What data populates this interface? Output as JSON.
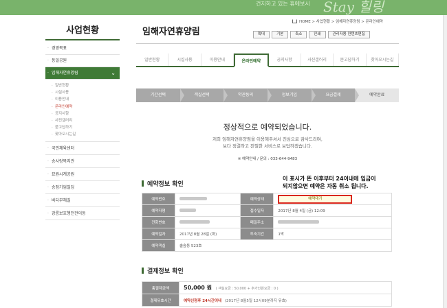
{
  "header": {
    "slogan": "건지하고 있는 휴에보시",
    "stay_logo": "Stay 힐링"
  },
  "sidebar": {
    "title": "사업현황",
    "items": [
      {
        "label": "경영목표"
      },
      {
        "label": "동일공원"
      },
      {
        "label": "임해자연휴양림",
        "active": true,
        "chevron": "⌄"
      },
      {
        "label": "국민체육센터"
      },
      {
        "label": "송사랑복지관"
      },
      {
        "label": "묘원시계공원"
      },
      {
        "label": "송정기업빌딩"
      },
      {
        "label": "바다부채길"
      },
      {
        "label": "강릉보호행전전이동"
      }
    ],
    "subitems": [
      {
        "label": "일반현황"
      },
      {
        "label": "시설사용"
      },
      {
        "label": "이용안내"
      },
      {
        "label": "온라인예약",
        "current": true
      },
      {
        "label": "공지사항"
      },
      {
        "label": "사진갤러리"
      },
      {
        "label": "묻고답하기"
      },
      {
        "label": "찾아오시는길"
      }
    ]
  },
  "main": {
    "title": "임해자연휴양림",
    "breadcrumb": "HOME  >  사업현황  >  임해자연휴양림  >  온라인예약",
    "util_buttons": [
      "확대",
      "기본",
      "축소",
      "인쇄",
      "관리자용 컨텐츠편집"
    ],
    "tabs": [
      {
        "label": "일반현황"
      },
      {
        "label": "시설사용"
      },
      {
        "label": "이용안내"
      },
      {
        "label": "온라인예약",
        "active": true
      },
      {
        "label": "공지사항"
      },
      {
        "label": "사진갤러리"
      },
      {
        "label": "묻고답하기"
      },
      {
        "label": "찾아오시는길"
      }
    ],
    "steps": [
      {
        "label": "기간선택"
      },
      {
        "label": "객실선택"
      },
      {
        "label": "약관동의"
      },
      {
        "label": "정보기입"
      },
      {
        "label": "요금결제"
      },
      {
        "label": "예약완료",
        "current": true
      }
    ],
    "complete": {
      "headline": "정상적으로 예약되었습니다.",
      "thanks_line1": "저희 임해자연휴양림을 이용해주셔서 진심으로 감사드리며,",
      "thanks_line2": "보다 정결하고 친절한 서비스로 보답하겠습니다.",
      "contact": "※ 예약안내 / 문의 : 033-644-9483"
    },
    "reservation_section_title": "예약정보 확인",
    "notice_line1": "이 표시가 뜬 이후부터 24이내에 입금이",
    "notice_line2": "되지않으면 예약은 자동 취소 됩니다.",
    "reservation": {
      "rows": [
        {
          "l1": "예약번호",
          "v1": "",
          "l2": "예약상태",
          "v2": "예약대기"
        },
        {
          "l1": "예약자명",
          "v1": "",
          "l2": "접수일자",
          "v2": "2017년 8월 4일 (금) 12:09"
        },
        {
          "l1": "전화번호",
          "v1": "",
          "l2": "메일주소",
          "v2": ""
        },
        {
          "l1": "예약일자",
          "v1": "2017년 8월 28일 (화)",
          "l2": "투숙기간",
          "v2": "1박"
        },
        {
          "l1": "예약객실",
          "v1": "솔숲동 523호"
        }
      ]
    },
    "payment_section_title": "결제정보 확인",
    "payment": {
      "total_label": "총결제금액",
      "total_value": "50,000 원",
      "total_note": "( 객실요금 : 50,000 + 추가인원요금 : 0 )",
      "due_label": "결제유효시간",
      "due_value": "예약신청후 24시간이내",
      "due_note": "(2017년 8월5일 12시09분까지 유효)"
    }
  },
  "colors": {
    "brand_green": "#3e6a34",
    "top_green": "#79b36b",
    "status_border": "#d9271e"
  }
}
